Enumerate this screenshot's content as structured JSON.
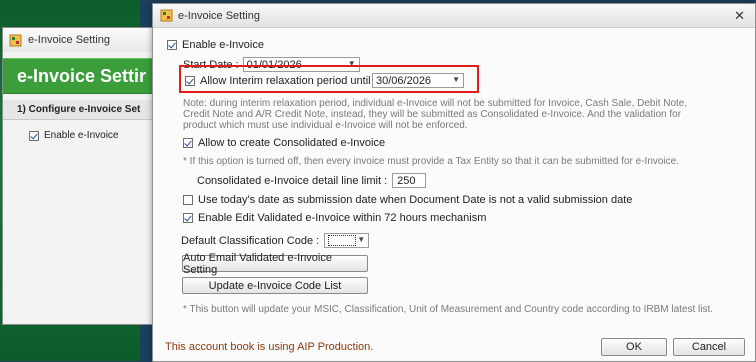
{
  "background_window": {
    "title": "e-Invoice Setting",
    "header": "e-Invoice Settir",
    "step": "1) Configure e-Invoice Set",
    "enable_label": "Enable e-Invoice",
    "enable_checked": true
  },
  "dialog": {
    "title": "e-Invoice Setting",
    "close_glyph": "✕",
    "enable": {
      "label": "Enable e-Invoice",
      "checked": true
    },
    "start_date": {
      "label": "Start Date :",
      "value": "01/01/2026"
    },
    "interim": {
      "label": "Allow Interim relaxation period until :",
      "checked": true,
      "value": "30/06/2026"
    },
    "interim_note": "Note: during interim relaxation period, individual e-Invoice will not be submitted for Invoice, Cash Sale, Debit Note, Credit Note and A/R Credit Note, instead, they will be submitted as Consolidated e-Invoice. And the validation for product which must use individual e-Invoice will not be enforced.",
    "consolidated": {
      "label": "Allow to create Consolidated e-Invoice",
      "checked": true
    },
    "consolidated_note": "* If this option is turned off, then every invoice must provide a Tax Entity so that it can be submitted for e-Invoice.",
    "line_limit": {
      "label": "Consolidated e-Invoice detail line limit :",
      "value": "250"
    },
    "use_today": {
      "label": "Use today's date as submission date when Document Date is not a valid submission date",
      "checked": false
    },
    "edit_validated": {
      "label": "Enable Edit Validated e-Invoice within 72 hours mechanism",
      "checked": true
    },
    "classification": {
      "label": "Default Classification Code :",
      "value": ""
    },
    "auto_email_button": "Auto Email Validated e-Invoice Setting",
    "update_code_button": "Update e-Invoice Code List",
    "update_note": "* This button will update your MSIC, Classification, Unit of Measurement and Country code according to IRBM latest list.",
    "footer_note": "This account book is using AIP Production.",
    "ok_button": "OK",
    "cancel_button": "Cancel"
  },
  "colors": {
    "highlight": "#e21b1b",
    "header_green": "#3b9e3b",
    "footer_text": "#8b3a0e"
  }
}
